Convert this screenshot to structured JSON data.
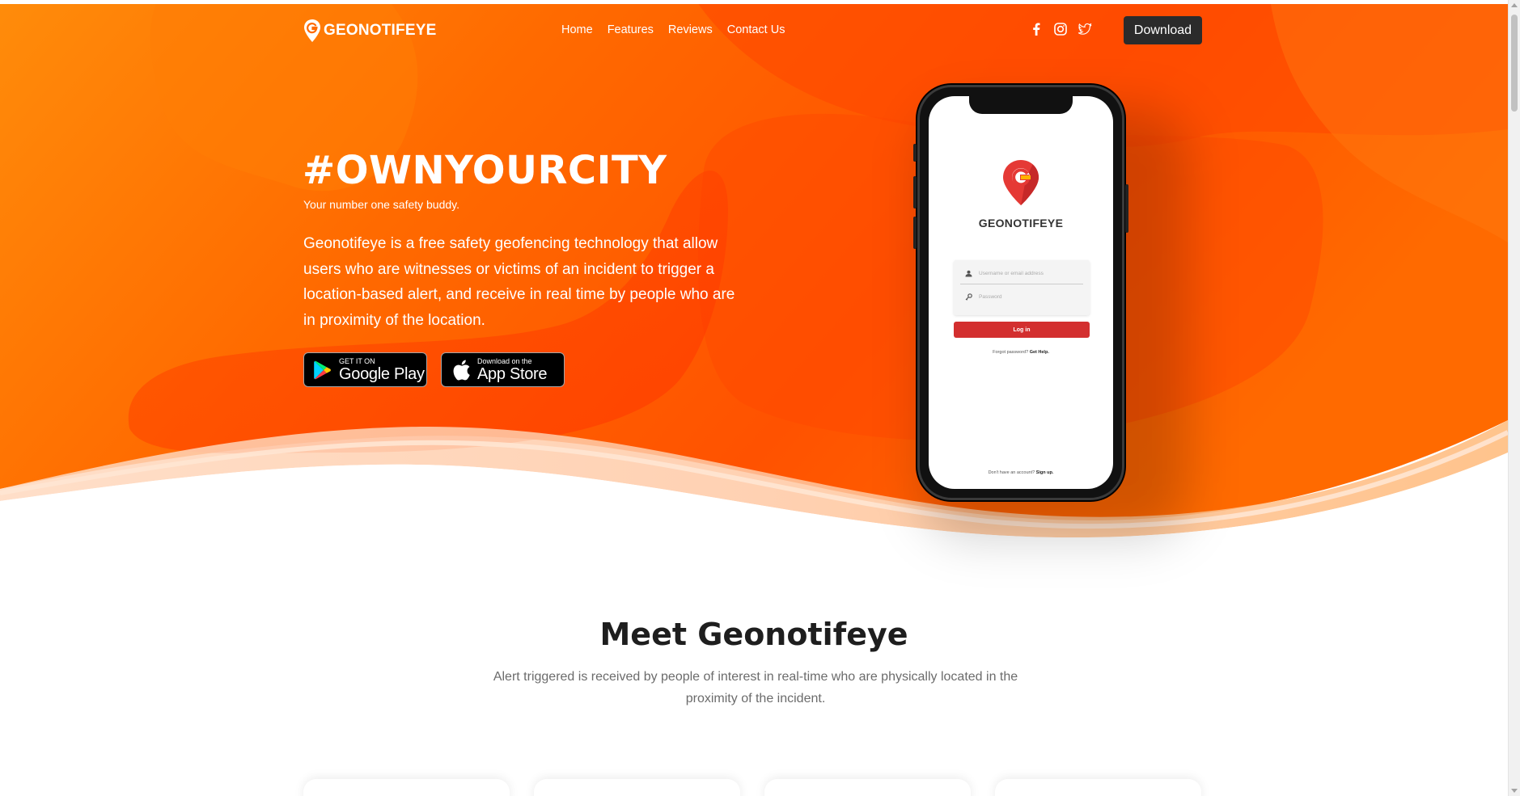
{
  "brand": {
    "name": "GEONOTIFEYE",
    "logo_icon": "map-pin-g-icon",
    "colors": {
      "primary": "#ff5a00",
      "accent": "#ff8a00",
      "dark": "#2b2b2b",
      "danger": "#d32f2f"
    }
  },
  "nav": {
    "links": [
      "Home",
      "Features",
      "Reviews",
      "Contact Us"
    ],
    "socials": [
      "facebook-icon",
      "instagram-icon",
      "twitter-icon"
    ],
    "download_label": "Download"
  },
  "hero": {
    "title": "#OWNYOURCITY",
    "subtitle": "Your number one safety buddy.",
    "description": "Geonotifeye is a free safety geofencing technology that allow users who are witnesses or victims of an incident to trigger a location-based alert, and receive in real time by people who are in proximity of the location.",
    "google_play": {
      "small": "GET IT ON",
      "big": "Google Play"
    },
    "app_store": {
      "small": "Download on the",
      "big": "App Store"
    }
  },
  "phone_app": {
    "name": "GEONOTIFEYE",
    "username_placeholder": "Username or email address",
    "password_placeholder": "Password",
    "login_label": "Log in",
    "forgot_text": "Forgot password?",
    "forgot_link": "Get Help.",
    "signup_text": "Don't have an account?",
    "signup_link": "Sign up."
  },
  "meet": {
    "title": "Meet Geonotifeye",
    "description": "Alert triggered is received by people of interest in real-time who are physically located in the proximity of the incident."
  }
}
